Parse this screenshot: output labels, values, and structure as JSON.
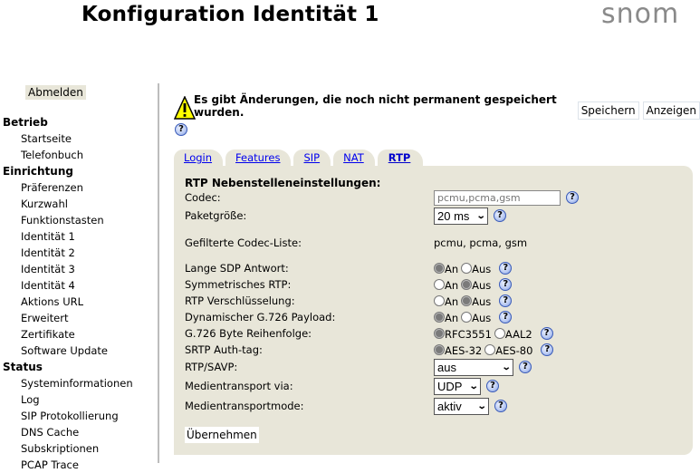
{
  "header": {
    "title": "Konfiguration Identität 1",
    "logo": "snom"
  },
  "sidebar": {
    "logout_label": "Abmelden",
    "sections": [
      {
        "label": "Betrieb",
        "items": [
          "Startseite",
          "Telefonbuch"
        ]
      },
      {
        "label": "Einrichtung",
        "items": [
          "Präferenzen",
          "Kurzwahl",
          "Funktionstasten",
          "Identität 1",
          "Identität 2",
          "Identität 3",
          "Identität 4",
          "Aktions URL",
          "Erweitert",
          "Zertifikate",
          "Software Update"
        ]
      },
      {
        "label": "Status",
        "items": [
          "Systeminformationen",
          "Log",
          "SIP Protokollierung",
          "DNS Cache",
          "Subskriptionen",
          "PCAP Trace"
        ]
      }
    ]
  },
  "notice": {
    "icon": "warning-icon",
    "text": "Es gibt Änderungen, die noch nicht permanent gespeichert wurden.",
    "save_label": "Speichern",
    "show_label": "Anzeigen",
    "help_glyph": "?"
  },
  "tabs": [
    {
      "label": "Login",
      "active": false
    },
    {
      "label": "Features",
      "active": false
    },
    {
      "label": "SIP",
      "active": false
    },
    {
      "label": "NAT",
      "active": false
    },
    {
      "label": "RTP",
      "active": true
    }
  ],
  "form": {
    "section_title": "RTP Nebenstelleneinstellungen:",
    "codec": {
      "label": "Codec:",
      "placeholder": "pcmu,pcma,gsm",
      "value": ""
    },
    "packet_size": {
      "label": "Paketgröße:",
      "value": "20 ms"
    },
    "filtered_codecs": {
      "label": "Gefilterte Codec-Liste:",
      "value": "pcmu, pcma, gsm"
    },
    "long_sdp": {
      "label": "Lange SDP Antwort:",
      "options": [
        "An",
        "Aus"
      ],
      "selected": "An"
    },
    "symmetric_rtp": {
      "label": "Symmetrisches RTP:",
      "options": [
        "An",
        "Aus"
      ],
      "selected": "Aus"
    },
    "rtp_encryption": {
      "label": "RTP Verschlüsselung:",
      "options": [
        "An",
        "Aus"
      ],
      "selected": "Aus"
    },
    "dyn_g726": {
      "label": "Dynamischer G.726 Payload:",
      "options": [
        "An",
        "Aus"
      ],
      "selected": "An"
    },
    "g726_order": {
      "label": "G.726 Byte Reihenfolge:",
      "options": [
        "RFC3551",
        "AAL2"
      ],
      "selected": "RFC3551"
    },
    "srtp_auth": {
      "label": "SRTP Auth-tag:",
      "options": [
        "AES-32",
        "AES-80"
      ],
      "selected": "AES-32"
    },
    "rtp_savp": {
      "label": "RTP/SAVP:",
      "value": "aus"
    },
    "media_transport": {
      "label": "Medientransport via:",
      "value": "UDP"
    },
    "media_mode": {
      "label": "Medientransportmode:",
      "value": "aktiv"
    },
    "apply_label": "Übernehmen"
  }
}
